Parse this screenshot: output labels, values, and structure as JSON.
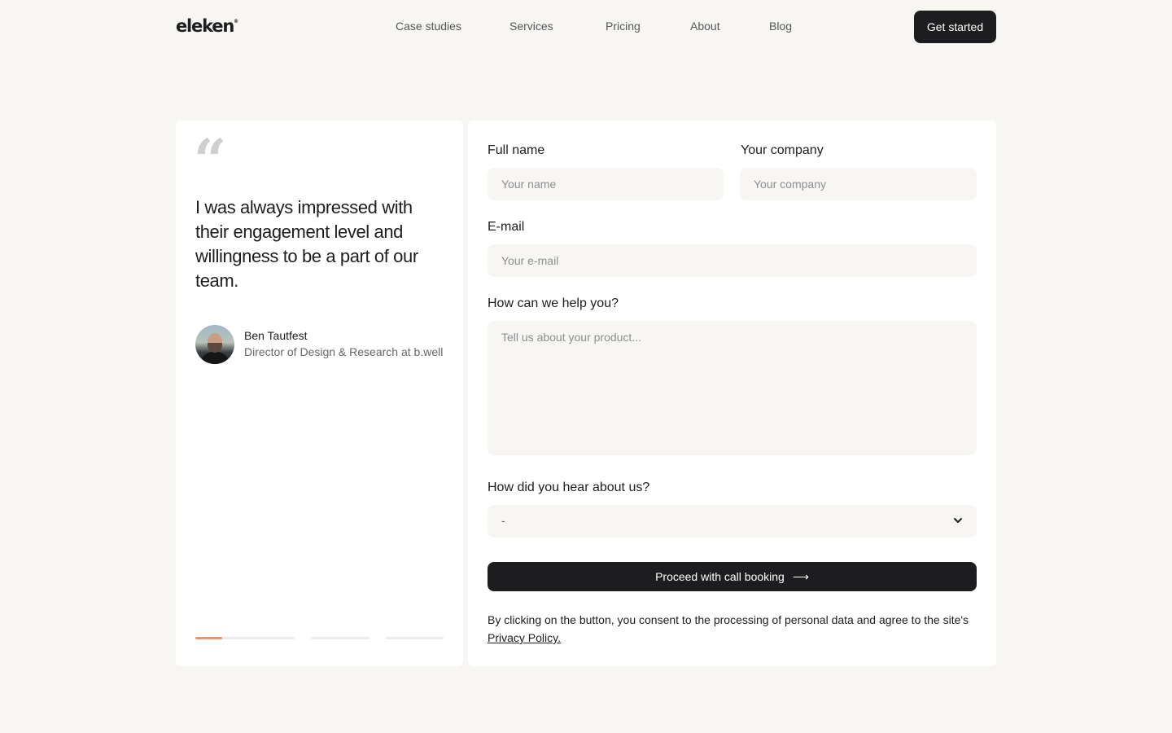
{
  "header": {
    "logo": "eleken",
    "logo_mark": "®",
    "nav": [
      {
        "label": "Case studies"
      },
      {
        "label": "Services"
      },
      {
        "label": "Pricing"
      },
      {
        "label": "About"
      },
      {
        "label": "Blog"
      }
    ],
    "cta_label": "Get started"
  },
  "testimonial": {
    "quote_mark": "“",
    "quote": "I was always impressed with their engagement level and willingness to be a part of our team.",
    "author_name": "Ben Tautfest",
    "author_role": "Director of Design & Research at b.well",
    "slides_total": 3,
    "active_slide": 1,
    "active_slide_progress": 0.27
  },
  "form": {
    "full_name": {
      "label": "Full name",
      "placeholder": "Your name",
      "value": ""
    },
    "company": {
      "label": "Your company",
      "placeholder": "Your company",
      "value": ""
    },
    "email": {
      "label": "E-mail",
      "placeholder": "Your e-mail",
      "value": ""
    },
    "help": {
      "label": "How can we help you?",
      "placeholder": "Tell us about your product...",
      "value": ""
    },
    "source": {
      "label": "How did you hear about us?",
      "selected": "-"
    },
    "submit_label": "Proceed with call booking",
    "submit_arrow": "⟶",
    "consent_text": "By clicking on the button, you consent to the processing of personal data and agree to the site's",
    "privacy_link": "Privacy Policy."
  },
  "colors": {
    "background": "#f7f6f3",
    "dark": "#1d1d1f",
    "accent": "#e8956a"
  },
  "icons": {
    "quote": "quote-icon",
    "select": "chevron-down-icon",
    "submit": "arrow-right-icon"
  }
}
